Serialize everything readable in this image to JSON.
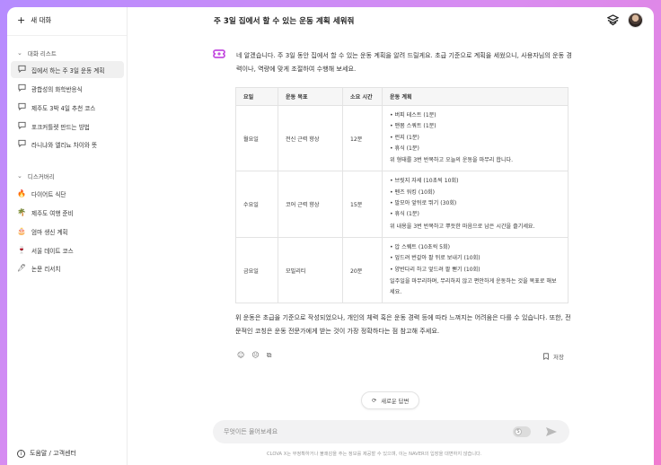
{
  "sidebar": {
    "new_chat_label": "새 대화",
    "chat_list_header": "대화 리스트",
    "chat_items": [
      {
        "label": "집에서 하는 주 3일 운동 계획",
        "active": true
      },
      {
        "label": "광합성의 화학반응식"
      },
      {
        "label": "제주도 3박 4일 추천 코스"
      },
      {
        "label": "포크커틀렛 만드는 방법"
      },
      {
        "label": "라니냐와 엘리뇨 차이와 뜻"
      }
    ],
    "discovery_header": "디스커버리",
    "discovery_items": [
      {
        "label": "다이어트 식단",
        "icon": "fire-icon",
        "glyph": "🔥"
      },
      {
        "label": "제주도 여행 준비",
        "icon": "palm-tree-icon",
        "glyph": "🌴"
      },
      {
        "label": "엄마 생신 계획",
        "icon": "cake-icon",
        "glyph": "🎂"
      },
      {
        "label": "서울 데이트 코스",
        "icon": "wine-glass-icon",
        "glyph": "🍷"
      },
      {
        "label": "논문 리서치",
        "icon": "pen-icon",
        "glyph": "🖊"
      }
    ],
    "help_label": "도움말 / 고객센터"
  },
  "header": {
    "title": "주 3일  집에서 할 수 있는 운동 계획 세워줘"
  },
  "response": {
    "intro": "네 알겠습니다. 주 3일 동안 집에서 할 수 있는 운동 계획을 알려 드릴게요. 초급 기준으로 계획을 세웠으니, 사용자님의 운동 경력이나, 역량에 맞게 조절하여 수행해 보세요.",
    "table": {
      "headers": [
        "요일",
        "운동 목표",
        "소요 시간",
        "운동 계획"
      ],
      "rows": [
        {
          "day": "월요일",
          "goal": "전신 근력 향상",
          "time": "12분",
          "plan": [
            "• 버피 테스트 (1분)",
            "• 맨몸 스쿼트 (1분)",
            "• 런지 (1분)",
            "• 휴식 (1분)"
          ],
          "note": "위 형태를 3번 반복하고 오늘의 운동을 마무리 합니다."
        },
        {
          "day": "수요일",
          "goal": "코어 근력 향상",
          "time": "15분",
          "plan": [
            "• 브릿지 자세 (10초씩 10회)",
            "• 펜즈 워킹 (10회)",
            "• 발모아 앞뒤로 뛰기 (30회)",
            "• 휴식 (1분)"
          ],
          "note": "위 내용을 3번 반복하고 뿌듯한 마음으로 남은 시간을 즐기세요."
        },
        {
          "day": "금요일",
          "goal": "모빌리티",
          "time": "20분",
          "plan": [
            "• 압 스퀘트 (10초씩 5회)",
            "• 엎드려 번갈아 팔 뒤로 보내기 (10회)",
            "• 양반다리 하고 엎드려 팔 뻗기 (10회)"
          ],
          "note": "일주일을 마무리하며, 무리하지 않고 편안하게 운동하는 것을 목표로 해보세요."
        }
      ]
    },
    "outro": "위 운동은 초급을 기준으로 작성되었으나, 개인의 체력 혹은 운동 경력 등에 따라 느껴지는 어려움은 다를 수 있습니다. 또한, 전문적인 코칭은 운동 전문가에게 받는 것이 가장 정확하다는 점 참고해 주세요.",
    "save_label": "저장"
  },
  "regenerate_label": "새로운 답변",
  "input": {
    "placeholder": "무엇이든 물어보세요",
    "toggle_glyph": "S"
  },
  "disclaimer": "CLOVA X는 부정확하거나 불쾌감을 주는 정보를 제공할 수 있으며, 이는 NAVER의 입장을 대변하지 않습니다.",
  "colors": {
    "background_gradient_start": "#b58cff",
    "background_gradient_end": "#f07ccf",
    "bot_icon": "#c44fe0",
    "active_item_bg": "#f0f0f0"
  }
}
